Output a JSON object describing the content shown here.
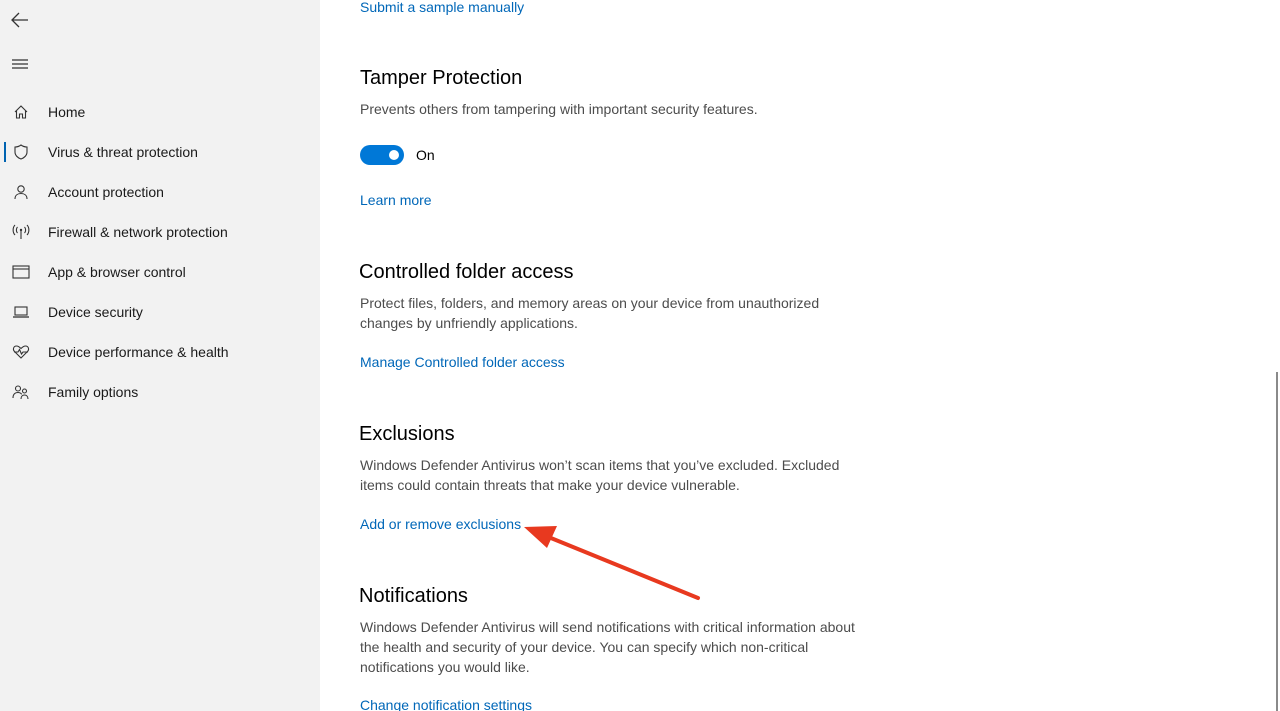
{
  "sidebar": {
    "back_icon": "back-arrow-icon",
    "menu_icon": "hamburger-menu-icon",
    "items": [
      {
        "label": "Home",
        "icon": "home-icon",
        "active": false
      },
      {
        "label": "Virus & threat protection",
        "icon": "shield-icon",
        "active": true
      },
      {
        "label": "Account protection",
        "icon": "person-icon",
        "active": false
      },
      {
        "label": "Firewall & network protection",
        "icon": "antenna-icon",
        "active": false
      },
      {
        "label": "App & browser control",
        "icon": "browser-window-icon",
        "active": false
      },
      {
        "label": "Device security",
        "icon": "laptop-icon",
        "active": false
      },
      {
        "label": "Device performance & health",
        "icon": "heart-pulse-icon",
        "active": false
      },
      {
        "label": "Family options",
        "icon": "family-icon",
        "active": false
      }
    ]
  },
  "main": {
    "submit_sample_link": "Submit a sample manually",
    "tamper": {
      "title": "Tamper Protection",
      "description": "Prevents others from tampering with important security features.",
      "toggle_state": "On",
      "learn_more_link": "Learn more"
    },
    "controlled_folder": {
      "title": "Controlled folder access",
      "description": "Protect files, folders, and memory areas on your device from unauthorized changes by unfriendly applications.",
      "manage_link": "Manage Controlled folder access"
    },
    "exclusions": {
      "title": "Exclusions",
      "description": "Windows Defender Antivirus won’t scan items that you’ve excluded. Excluded items could contain threats that make your device vulnerable.",
      "add_remove_link": "Add or remove exclusions"
    },
    "notifications": {
      "title": "Notifications",
      "description": "Windows Defender Antivirus will send notifications with critical information about the health and security of your device. You can specify which non-critical notifications you would like.",
      "change_link": "Change notification settings"
    }
  },
  "colors": {
    "accent": "#0078d7",
    "link": "#0067b8",
    "sidebar_bg": "#f2f2f2",
    "annotation_arrow": "#e8391f"
  }
}
